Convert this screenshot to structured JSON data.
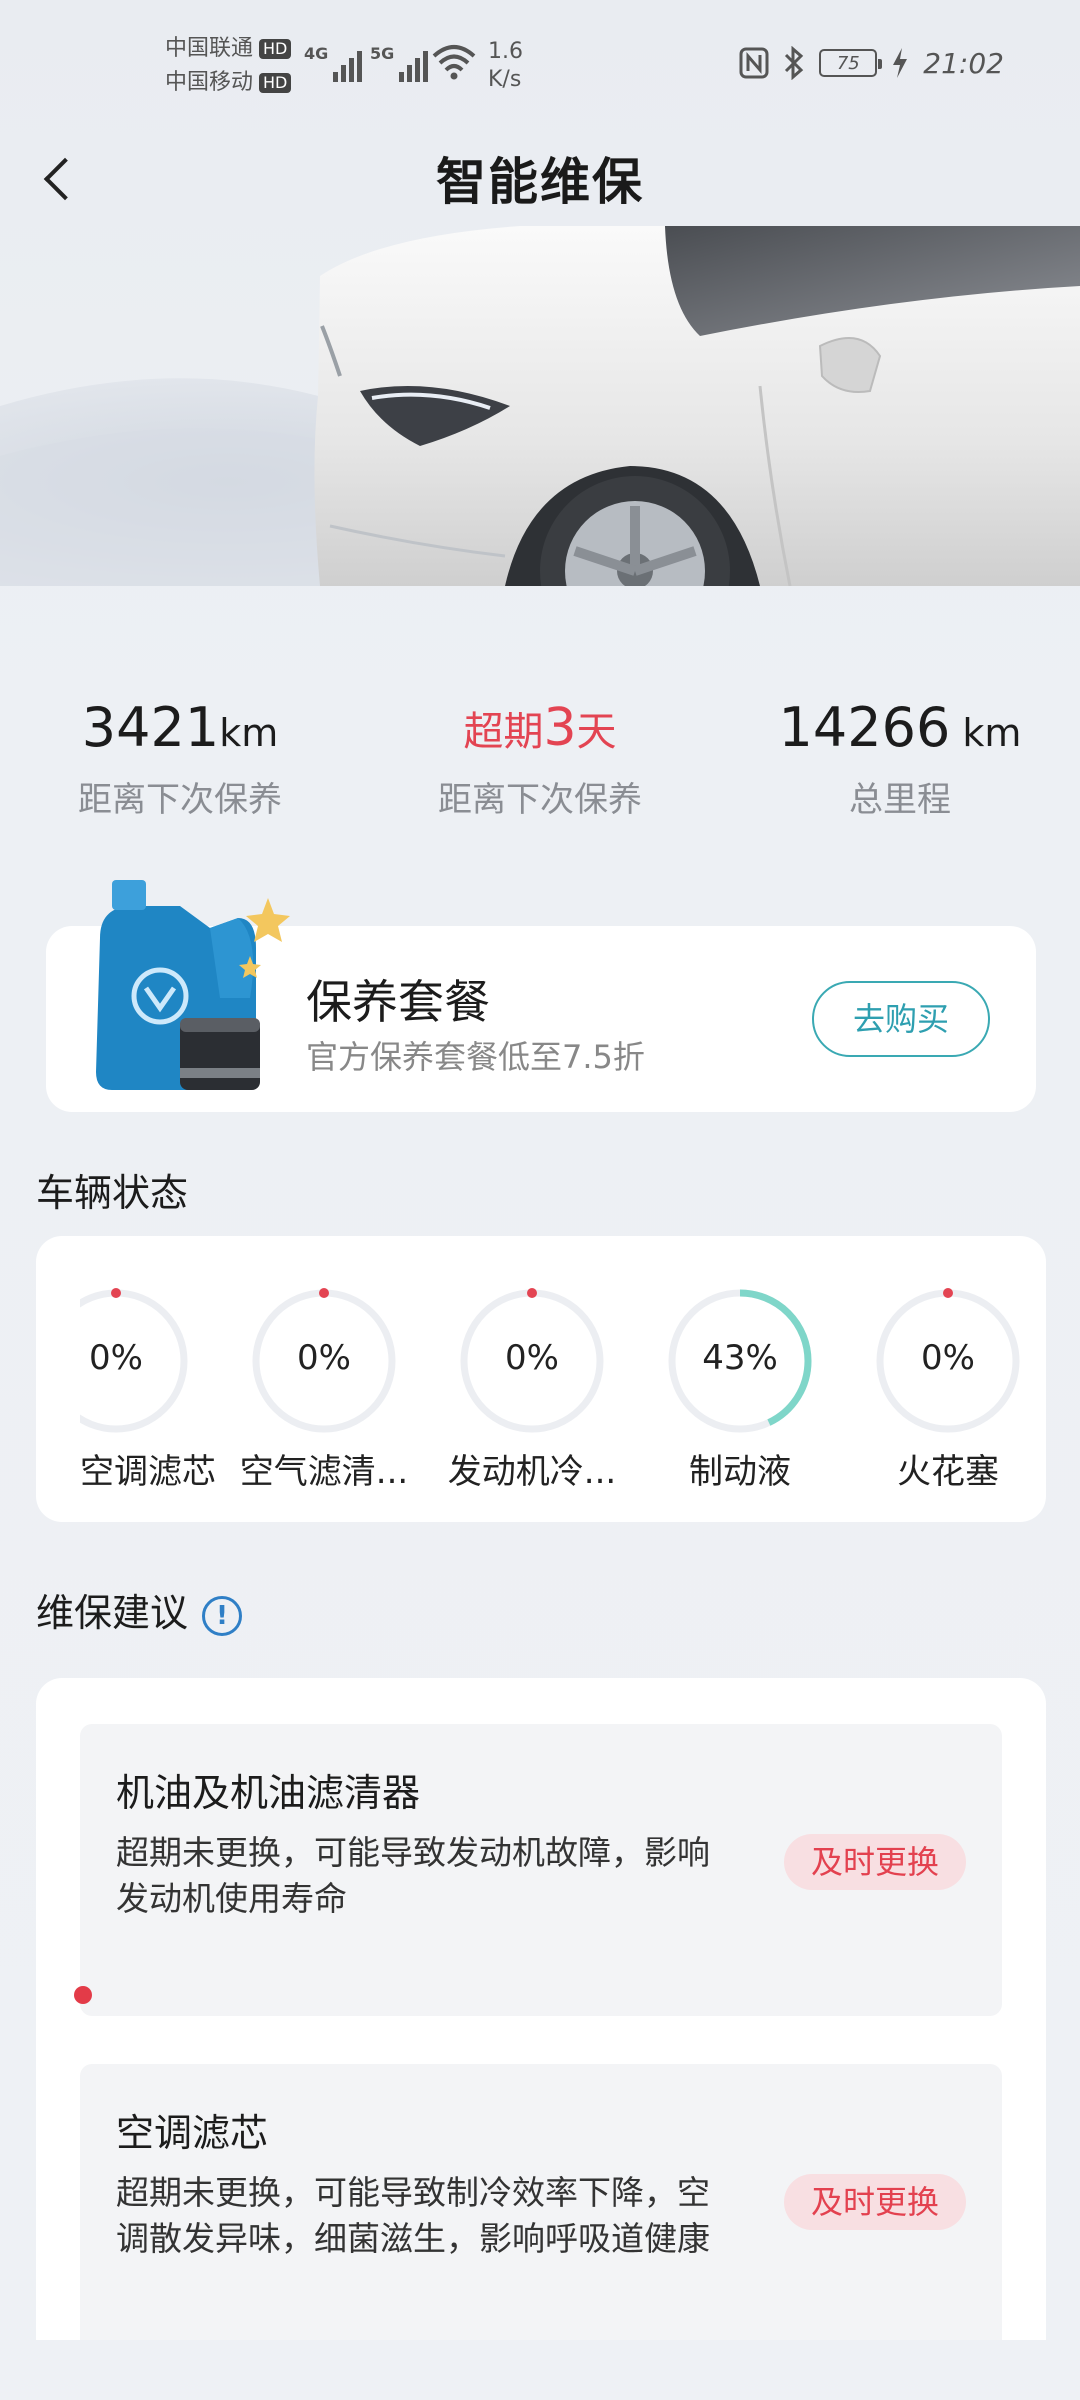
{
  "status_bar": {
    "carrier1": "中国联通",
    "carrier2": "中国移动",
    "hd": "HD",
    "net1": "4G",
    "net2": "5G",
    "speed_value": "1.6",
    "speed_unit": "K/s",
    "battery": "75",
    "time": "21:02"
  },
  "header": {
    "title": "智能维保"
  },
  "stats": [
    {
      "value": "3421",
      "unit": "km",
      "label": "距离下次保养"
    },
    {
      "prefix": "超期",
      "value": "3",
      "unit": "天",
      "label": "距离下次保养"
    },
    {
      "value": "14266",
      "unit": " km",
      "label": "总里程"
    }
  ],
  "package": {
    "title": "保养套餐",
    "subtitle": "官方保养套餐低至7.5折",
    "button": "去购买"
  },
  "vehicle_status": {
    "title": "车辆状态",
    "items": [
      {
        "name": "空调滤芯",
        "percent": 0,
        "label": "0%"
      },
      {
        "name": "空气滤清...",
        "percent": 0,
        "label": "0%"
      },
      {
        "name": "发动机冷...",
        "percent": 0,
        "label": "0%"
      },
      {
        "name": "制动液",
        "percent": 43,
        "label": "43%"
      },
      {
        "name": "火花塞",
        "percent": 0,
        "label": "0%"
      }
    ]
  },
  "advice": {
    "title": "维保建议",
    "info_icon": "!",
    "items": [
      {
        "title": "机油及机油滤清器",
        "desc": "超期未更换，可能导致发动机故障，影响发动机使用寿命",
        "tag": "及时更换"
      },
      {
        "title": "空调滤芯",
        "desc": "超期未更换，可能导致制冷效率下降，空调散发异味，细菌滋生，影响呼吸道健康",
        "tag": "及时更换"
      }
    ]
  },
  "colors": {
    "accent_teal": "#3aa9b3",
    "alert_red": "#e34452",
    "gauge_track": "#eceef2",
    "gauge_fill": "#7fd6c9"
  }
}
